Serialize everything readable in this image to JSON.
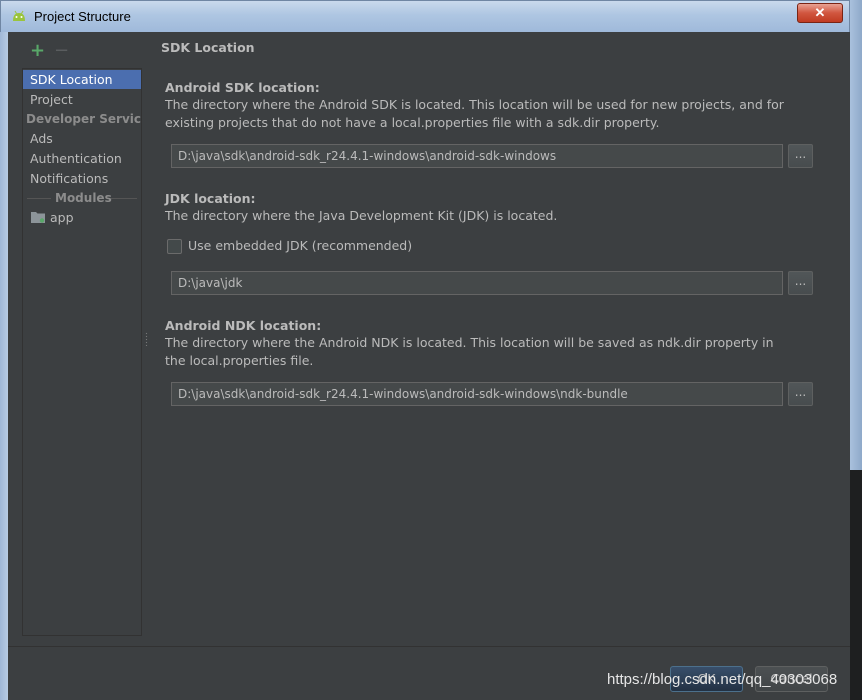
{
  "window": {
    "title": "Project Structure",
    "close_label": "✕"
  },
  "toolbar": {
    "add_label": "+",
    "remove_label": "−"
  },
  "sidebar": {
    "items": [
      {
        "label": "SDK Location",
        "selected": true
      },
      {
        "label": "Project"
      }
    ],
    "group_developer": "Developer Servic...",
    "developer_items": [
      {
        "label": "Ads"
      },
      {
        "label": "Authentication"
      },
      {
        "label": "Notifications"
      }
    ],
    "modules_label": "Modules",
    "module_items": [
      {
        "label": "app",
        "icon": "module-folder-icon"
      }
    ]
  },
  "content": {
    "section_title": "SDK Location",
    "android_sdk": {
      "label": "Android SDK location:",
      "description": "The directory where the Android SDK is located. This location will be used for new projects, and for existing projects that do not have a local.properties file with a sdk.dir property.",
      "path": "D:\\java\\sdk\\android-sdk_r24.4.1-windows\\android-sdk-windows",
      "browse_label": "..."
    },
    "jdk": {
      "label": "JDK location:",
      "description": "The directory where the Java Development Kit (JDK) is located.",
      "checkbox_label": "Use embedded JDK (recommended)",
      "checkbox_checked": false,
      "path": "D:\\java\\jdk",
      "browse_label": "..."
    },
    "ndk": {
      "label": "Android NDK location:",
      "description": "The directory where the Android NDK is located. This location will be saved as ndk.dir property in the local.properties file.",
      "path": "D:\\java\\sdk\\android-sdk_r24.4.1-windows\\android-sdk-windows\\ndk-bundle",
      "browse_label": "..."
    }
  },
  "buttons": {
    "ok": "OK",
    "cancel": "Cancel"
  },
  "watermark": "https://blog.csdn.net/qq_40303068",
  "colors": {
    "background": "#3c3f41",
    "selection": "#4b6eaf",
    "add_green": "#59a869"
  }
}
